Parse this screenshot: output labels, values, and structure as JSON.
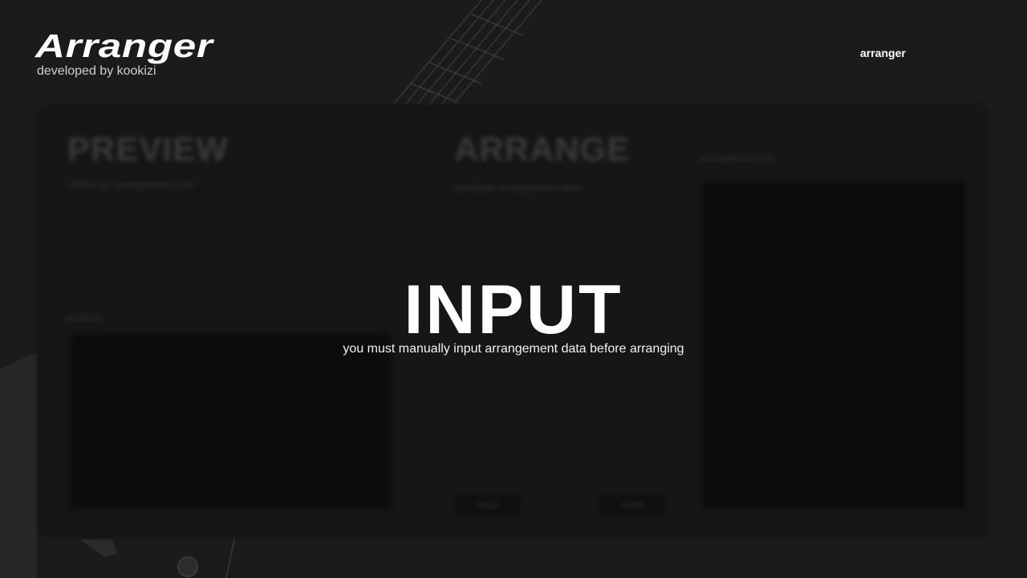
{
  "header": {
    "title": "Arranger",
    "subtitle": "developed by kookizi",
    "nav_link": "arranger"
  },
  "background": {
    "preview_heading": "PREVIEW",
    "preview_sub": "select an arrangement part",
    "arrange_heading": "ARRANGE",
    "arrange_sub": "available arrangement parts",
    "arrangement_list_label": "arrangement list",
    "section_label": "sections",
    "button_left": "reset",
    "button_right": "build"
  },
  "overlay": {
    "title": "INPUT",
    "message": "you must manually input arrangement data before arranging"
  }
}
